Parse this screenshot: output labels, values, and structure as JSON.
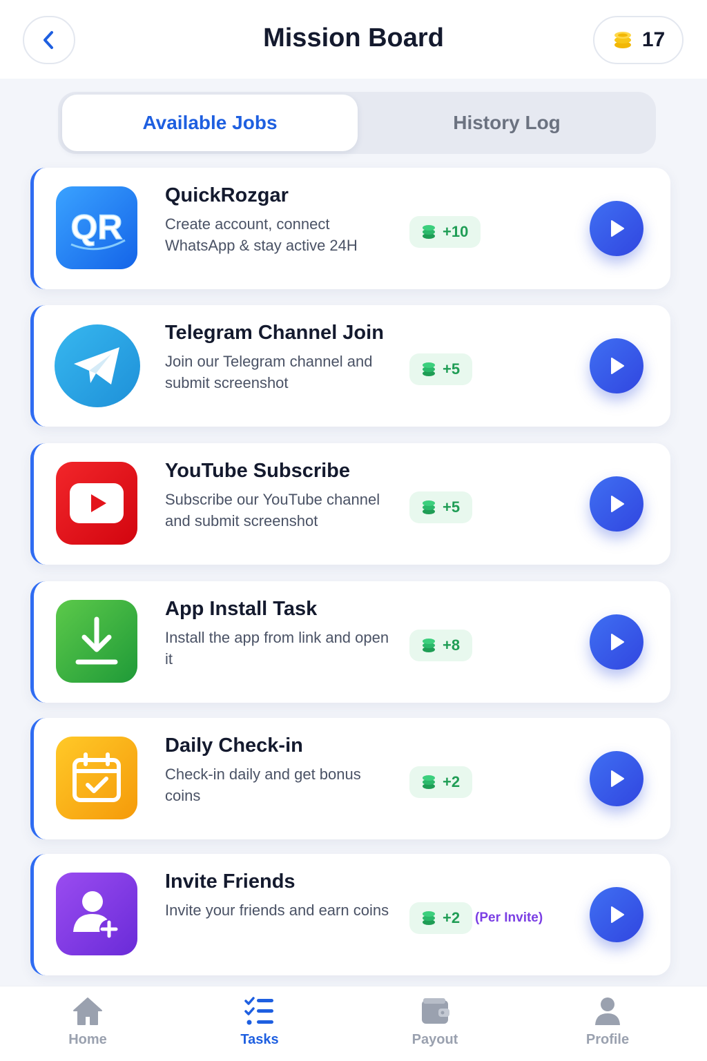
{
  "header": {
    "title": "Mission Board",
    "coins": "17"
  },
  "tabs": [
    {
      "label": "Available Jobs",
      "active": true
    },
    {
      "label": "History Log",
      "active": false
    }
  ],
  "jobs": [
    {
      "title": "QuickRozgar",
      "description": "Create account, connect WhatsApp & stay active 24H",
      "reward": "+10",
      "icon": "quickrozgar-logo"
    },
    {
      "title": "Telegram Channel Join",
      "description": "Join our Telegram channel and submit screenshot",
      "reward": "+5",
      "icon": "telegram-icon"
    },
    {
      "title": "YouTube Subscribe",
      "description": "Subscribe our YouTube channel and submit screenshot",
      "reward": "+5",
      "icon": "youtube-icon"
    },
    {
      "title": "App Install Task",
      "description": "Install the app from link and open it",
      "reward": "+8",
      "icon": "download-icon"
    },
    {
      "title": "Daily Check-in",
      "description": "Check-in daily and get bonus coins",
      "reward": "+2",
      "icon": "calendar-check-icon"
    },
    {
      "title": "Invite Friends",
      "description": "Invite your friends and earn coins",
      "reward": "+2",
      "reward_note": "(Per Invite)",
      "icon": "add-user-icon"
    }
  ],
  "logo_text": "QR",
  "nav": [
    {
      "label": "Home",
      "icon": "home-icon",
      "active": false
    },
    {
      "label": "Tasks",
      "icon": "tasks-icon",
      "active": true
    },
    {
      "label": "Payout",
      "icon": "wallet-icon",
      "active": false
    },
    {
      "label": "Profile",
      "icon": "profile-icon",
      "active": false
    }
  ],
  "colors": {
    "accent": "#2f6cf2",
    "reward_green": "#1f9d55",
    "reward_bg": "#e8f8ee",
    "purple": "#7b3fe4"
  }
}
